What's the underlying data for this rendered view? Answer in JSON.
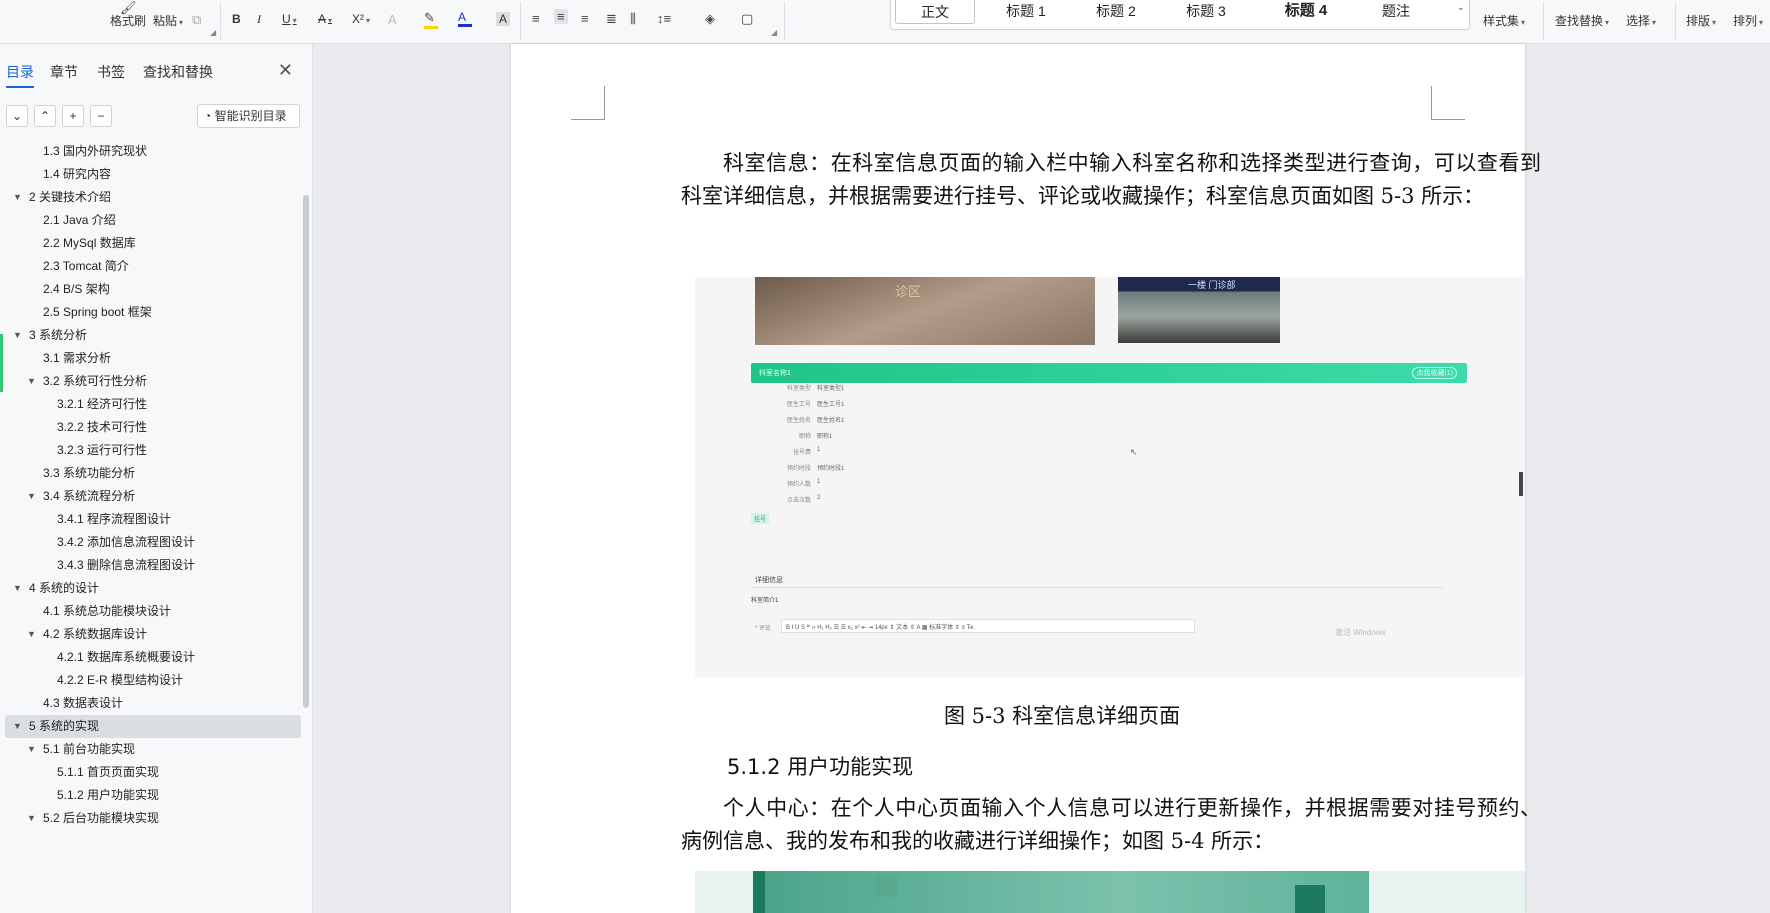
{
  "ribbon": {
    "format_painter": "格式刷",
    "paste": "粘贴",
    "bold": "B",
    "italic": "I",
    "underline": "U",
    "strike": "A",
    "superscript": "X²",
    "font_color_glyph": "A",
    "char_shade_glyph": "A",
    "styles": [
      "正文",
      "标题 1",
      "标题 2",
      "标题 3",
      "标题 4",
      "题注"
    ],
    "style_set": "样式集",
    "find_replace": "查找替换",
    "select": "选择",
    "arrange": "排版",
    "order": "排列"
  },
  "sidebar": {
    "tabs": [
      "目录",
      "章节",
      "书签",
      "查找和替换"
    ],
    "smart_toc": "智能识别目录",
    "toc": [
      {
        "label": "1.3  国内外研究现状",
        "level": 2,
        "arrow": ""
      },
      {
        "label": "1.4  研究内容",
        "level": 2,
        "arrow": ""
      },
      {
        "label": "2   关键技术介绍",
        "level": 1,
        "arrow": "▼"
      },
      {
        "label": "2.1 Java 介绍",
        "level": 2,
        "arrow": ""
      },
      {
        "label": "2.2 MySql 数据库",
        "level": 2,
        "arrow": ""
      },
      {
        "label": "2.3 Tomcat 简介",
        "level": 2,
        "arrow": ""
      },
      {
        "label": "2.4 B/S 架构",
        "level": 2,
        "arrow": ""
      },
      {
        "label": "2.5 Spring boot 框架",
        "level": 2,
        "arrow": ""
      },
      {
        "label": "3   系统分析",
        "level": 1,
        "arrow": "▼"
      },
      {
        "label": "3.1 需求分析",
        "level": 2,
        "arrow": ""
      },
      {
        "label": "3.2  系统可行性分析",
        "level": 2,
        "arrow": "▼"
      },
      {
        "label": "3.2.1 经济可行性",
        "level": 3,
        "arrow": ""
      },
      {
        "label": "3.2.2 技术可行性",
        "level": 3,
        "arrow": ""
      },
      {
        "label": "3.2.3 运行可行性",
        "level": 3,
        "arrow": ""
      },
      {
        "label": "3.3  系统功能分析",
        "level": 2,
        "arrow": ""
      },
      {
        "label": "3.4 系统流程分析",
        "level": 2,
        "arrow": "▼"
      },
      {
        "label": "3.4.1 程序流程图设计",
        "level": 3,
        "arrow": ""
      },
      {
        "label": "3.4.2 添加信息流程图设计",
        "level": 3,
        "arrow": ""
      },
      {
        "label": "3.4.3 删除信息流程图设计",
        "level": 3,
        "arrow": ""
      },
      {
        "label": "4   系统的设计",
        "level": 1,
        "arrow": "▼"
      },
      {
        "label": "4.1  系统总功能模块设计",
        "level": 2,
        "arrow": ""
      },
      {
        "label": "4.2  系统数据库设计",
        "level": 2,
        "arrow": "▼"
      },
      {
        "label": "4.2.1  数据库系统概要设计",
        "level": 3,
        "arrow": ""
      },
      {
        "label": "4.2.2 E-R 模型结构设计",
        "level": 3,
        "arrow": ""
      },
      {
        "label": "4.3 数据表设计",
        "level": 2,
        "arrow": ""
      },
      {
        "label": "5   系统的实现",
        "level": 1,
        "arrow": "▼",
        "selected": true
      },
      {
        "label": "5.1 前台功能实现",
        "level": 2,
        "arrow": "▼"
      },
      {
        "label": "5.1.1 首页页面实现",
        "level": 3,
        "arrow": ""
      },
      {
        "label": "5.1.2 用户功能实现",
        "level": 3,
        "arrow": ""
      },
      {
        "label": "5.2 后台功能模块实现",
        "level": 2,
        "arrow": "▼"
      }
    ]
  },
  "document": {
    "para1": "科室信息：在科室信息页面的输入栏中输入科室名称和选择类型进行查询，可以查看到科室详细信息，并根据需要进行挂号、评论或收藏操作；科室信息页面如图 5-3 所示：",
    "fig53_caption": "图 5-3 科室信息详细页面",
    "heading_512": "5.1.2 用户功能实现",
    "para2": "个人中心：在个人中心页面输入个人信息可以进行更新操作，并根据需要对挂号预约、病例信息、我的发布和我的收藏进行详细操作；如图 5-4 所示："
  },
  "fig53": {
    "header_title": "科室名称1",
    "header_right": "点我收藏(1)",
    "fields": [
      {
        "k": "科室类型",
        "v": "科室类型1"
      },
      {
        "k": "医生工号",
        "v": "医生工号1"
      },
      {
        "k": "医生姓名",
        "v": "医生姓名1"
      },
      {
        "k": "职称",
        "v": "职称1"
      },
      {
        "k": "挂号费",
        "v": "1"
      },
      {
        "k": "预约时段",
        "v": "预约时段1"
      },
      {
        "k": "预约人数",
        "v": "1"
      },
      {
        "k": "点击次数",
        "v": "2"
      }
    ],
    "register_btn": "挂号",
    "detail_title": "详细信息",
    "intro": "科室简介1",
    "comment_label": "* 评论",
    "toolbar_text": "B  I  U  S   ❝  ‹›   H₁ H₂   ☰  ☰   x₂ x²   ⇤ ⇥    14px   ⇕   文本   ⇕   A  ▦   标准字体   ⇕   ≡   T̶x",
    "watermark": "激活 Windows",
    "photo1_text": "诊区",
    "photo2_text": "一楼 门诊部"
  },
  "colors": {
    "accent": "#1a66d6",
    "fig_header": "#1fc587",
    "selection": "#dadde2"
  }
}
